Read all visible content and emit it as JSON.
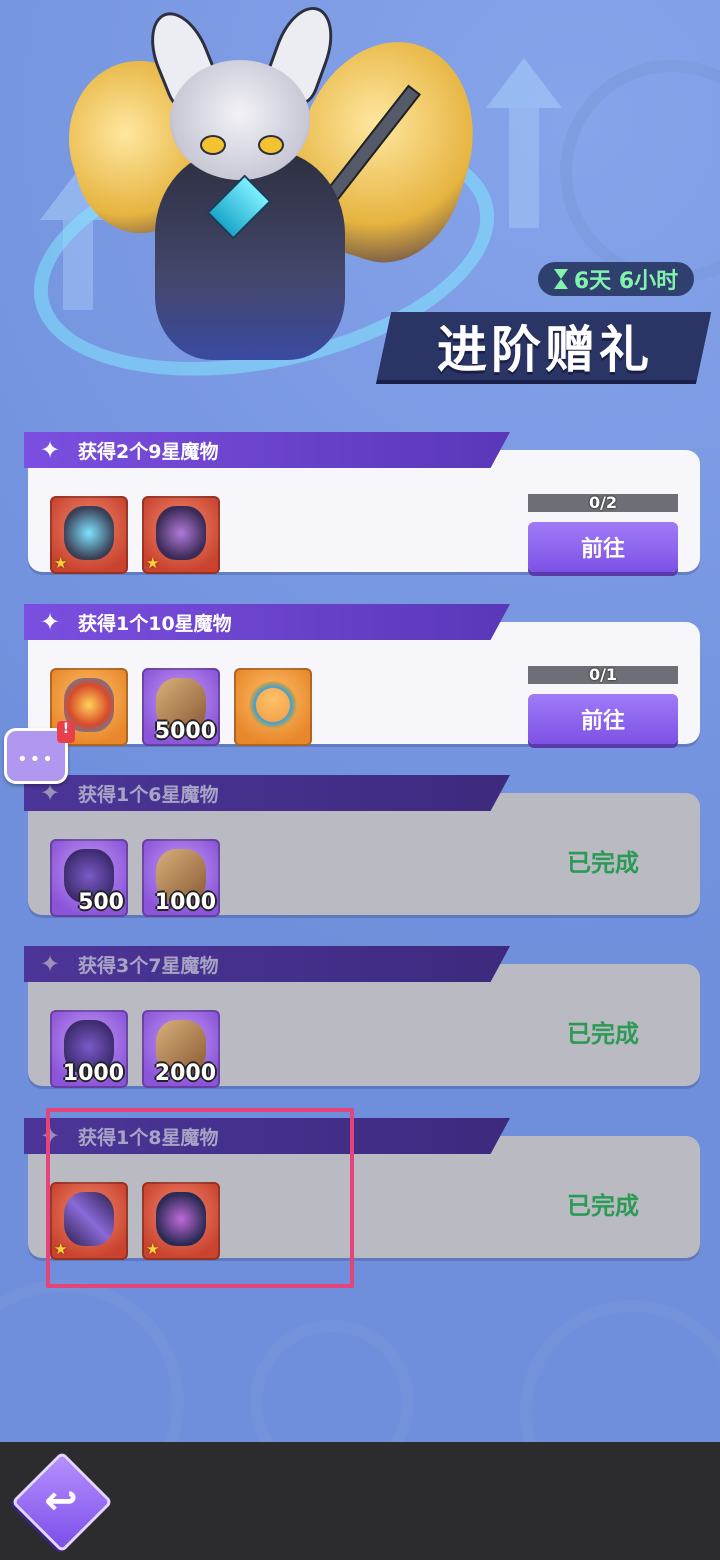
{
  "timer": {
    "text": "6天 6小时"
  },
  "event_title": "进阶赠礼",
  "tasks": [
    {
      "title": "获得2个9星魔物",
      "status": "active",
      "progress": {
        "text": "0/2",
        "current": 0,
        "total": 2
      },
      "button_label": "前往",
      "rewards": [
        {
          "icon": "monster-ring-icon",
          "color": "red",
          "star": "★",
          "qty": ""
        },
        {
          "icon": "monster-armor-icon",
          "color": "red",
          "star": "★",
          "qty": ""
        }
      ]
    },
    {
      "title": "获得1个10星魔物",
      "status": "active",
      "progress": {
        "text": "0/1",
        "current": 0,
        "total": 1
      },
      "button_label": "前往",
      "rewards": [
        {
          "icon": "golden-orb-icon",
          "color": "orange",
          "star": "",
          "qty": ""
        },
        {
          "icon": "scroll-icon",
          "color": "purple",
          "star": "",
          "qty": "5000"
        },
        {
          "icon": "jeweled-ring-icon",
          "color": "orange",
          "star": "",
          "qty": ""
        }
      ]
    },
    {
      "title": "获得1个6星魔物",
      "status": "done",
      "status_label": "已完成",
      "rewards": [
        {
          "icon": "purple-crystal-icon",
          "color": "purple",
          "star": "",
          "qty": "500"
        },
        {
          "icon": "scroll-icon",
          "color": "purple",
          "star": "",
          "qty": "1000"
        }
      ]
    },
    {
      "title": "获得3个7星魔物",
      "status": "done",
      "status_label": "已完成",
      "rewards": [
        {
          "icon": "purple-crystal-icon",
          "color": "purple",
          "star": "",
          "qty": "1000"
        },
        {
          "icon": "scroll-icon",
          "color": "purple",
          "star": "",
          "qty": "2000"
        }
      ]
    },
    {
      "title": "获得1个8星魔物",
      "status": "done",
      "status_label": "已完成",
      "rewards": [
        {
          "icon": "dark-sword-icon",
          "color": "red",
          "star": "★",
          "qty": ""
        },
        {
          "icon": "dark-cape-icon",
          "color": "red",
          "star": "★",
          "qty": ""
        }
      ]
    }
  ],
  "chat": {
    "dots": "•••",
    "alert": "!"
  },
  "colors": {
    "accent": "#7c52e6",
    "done_text": "#2c9a55",
    "timer_text": "#82f2ad",
    "highlight": "#e44479"
  }
}
